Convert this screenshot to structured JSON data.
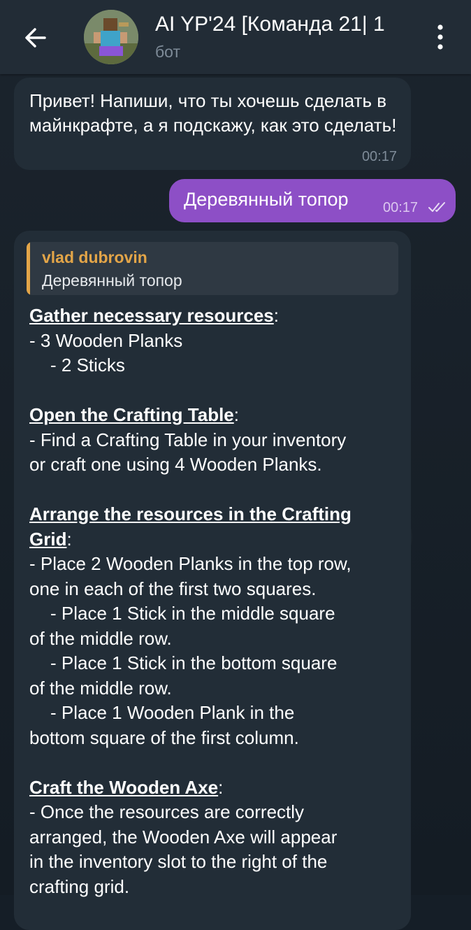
{
  "header": {
    "title": "AI YP'24 [Команда 21| 1",
    "subtitle": "бот",
    "back_icon": "arrow-left-icon",
    "menu_icon": "more-vertical-icon"
  },
  "messages": {
    "greeting": {
      "text": "Привет! Напиши, что ты хочешь сделать в майнкрафте, а я подскажу, как это сделать!",
      "time": "00:17"
    },
    "user": {
      "text": "Деревянный топор",
      "time": "00:17",
      "status_icon": "double-check-icon"
    },
    "reply": {
      "quote_author": "vlad dubrovin",
      "quote_text": "Деревянный топор",
      "sections": [
        {
          "heading": "Gather necessary resources",
          "lines": [
            "- 3 Wooden Planks",
            "- 2 Sticks"
          ]
        },
        {
          "heading": "Open the Crafting Table",
          "lines": [
            "- Find a Crafting Table in your inventory",
            "or craft one using 4 Wooden Planks."
          ]
        },
        {
          "heading_1": "Arrange the resources in the Crafting",
          "heading_2": "Grid",
          "lines": [
            "- Place 2 Wooden Planks in the top row,",
            "one in each of the first two squares.",
            "- Place 1 Stick in the middle square",
            "of the middle row.",
            "- Place 1 Stick in the bottom square",
            "of the middle row.",
            "- Place 1 Wooden Plank in the",
            "bottom square of the first column."
          ]
        },
        {
          "heading": "Craft the Wooden Axe",
          "lines": [
            "- Once the resources are correctly",
            "arranged, the Wooden Axe will appear",
            "in the inventory slot to the right of the",
            "crafting grid."
          ]
        }
      ],
      "colon": ":"
    }
  },
  "colors": {
    "header_bg": "#222c36",
    "incoming_bubble": "#222d37",
    "outgoing_bubble": "#8d4fc6",
    "quote_accent": "#e3a548"
  }
}
